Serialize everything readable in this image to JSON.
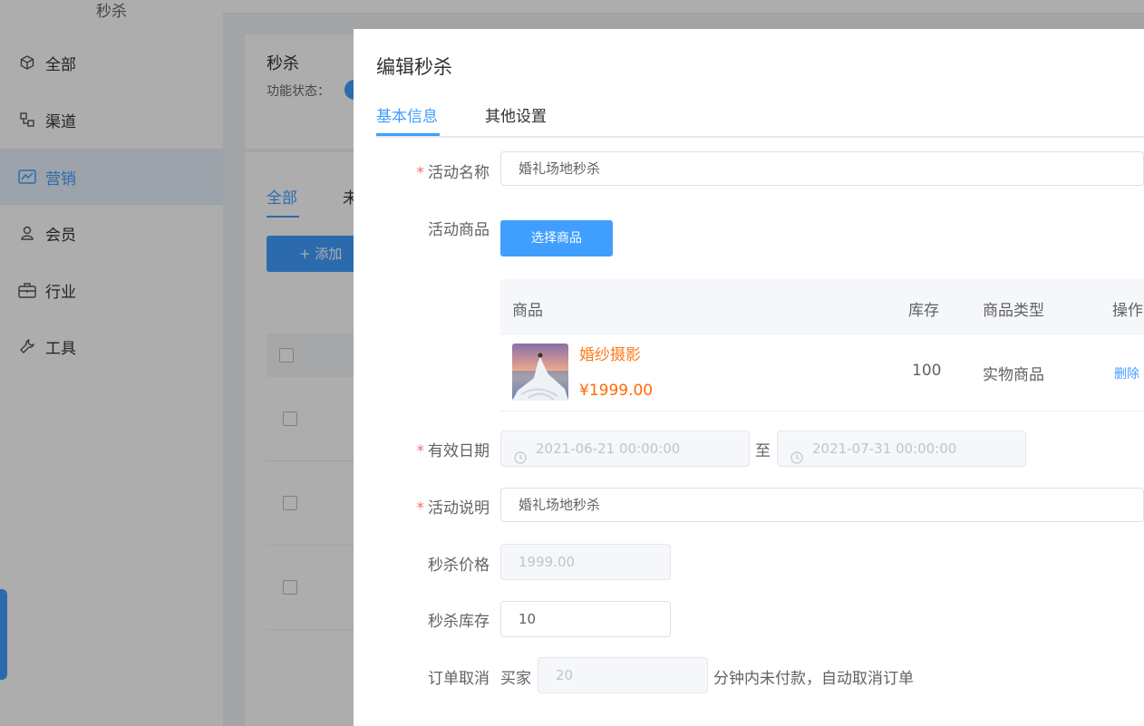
{
  "sidebar": {
    "top_label": "秒杀",
    "items": [
      {
        "label": "全部",
        "icon": "cube-icon"
      },
      {
        "label": "渠道",
        "icon": "channel-icon"
      },
      {
        "label": "营销",
        "icon": "chart-icon",
        "active": true
      },
      {
        "label": "会员",
        "icon": "user-icon"
      },
      {
        "label": "行业",
        "icon": "briefcase-icon"
      },
      {
        "label": "工具",
        "icon": "wrench-icon"
      }
    ]
  },
  "background": {
    "card_title": "秒杀",
    "status_label": "功能状态：",
    "tabs": [
      "全部",
      "未"
    ],
    "add_button": "+ 添加"
  },
  "dialog": {
    "title": "编辑秒杀",
    "tabs": [
      {
        "label": "基本信息",
        "active": true
      },
      {
        "label": "其他设置"
      }
    ],
    "activity_name": {
      "label": "活动名称",
      "required": true,
      "value": "婚礼场地秒杀"
    },
    "activity_goods": {
      "label": "活动商品",
      "button": "选择商品"
    },
    "goods_table": {
      "headers": [
        "商品",
        "库存",
        "商品类型",
        "操作"
      ],
      "rows": [
        {
          "name": "婚纱摄影",
          "price": "¥1999.00",
          "stock": "100",
          "type": "实物商品",
          "action": "删除"
        }
      ]
    },
    "valid_date": {
      "label": "有效日期",
      "required": true,
      "start": "2021-06-21 00:00:00",
      "separator": "至",
      "end": "2021-07-31 00:00:00"
    },
    "description": {
      "label": "活动说明",
      "required": true,
      "value": "婚礼场地秒杀"
    },
    "seckill_price": {
      "label": "秒杀价格",
      "value": "1999.00"
    },
    "seckill_stock": {
      "label": "秒杀库存",
      "value": "10"
    },
    "order_cancel": {
      "label": "订单取消",
      "prefix": "买家",
      "minutes": "20",
      "suffix": "分钟内未付款，自动取消订单"
    }
  },
  "colors": {
    "primary": "#409eff",
    "price": "#ff6a00",
    "required": "#f56c6c"
  }
}
